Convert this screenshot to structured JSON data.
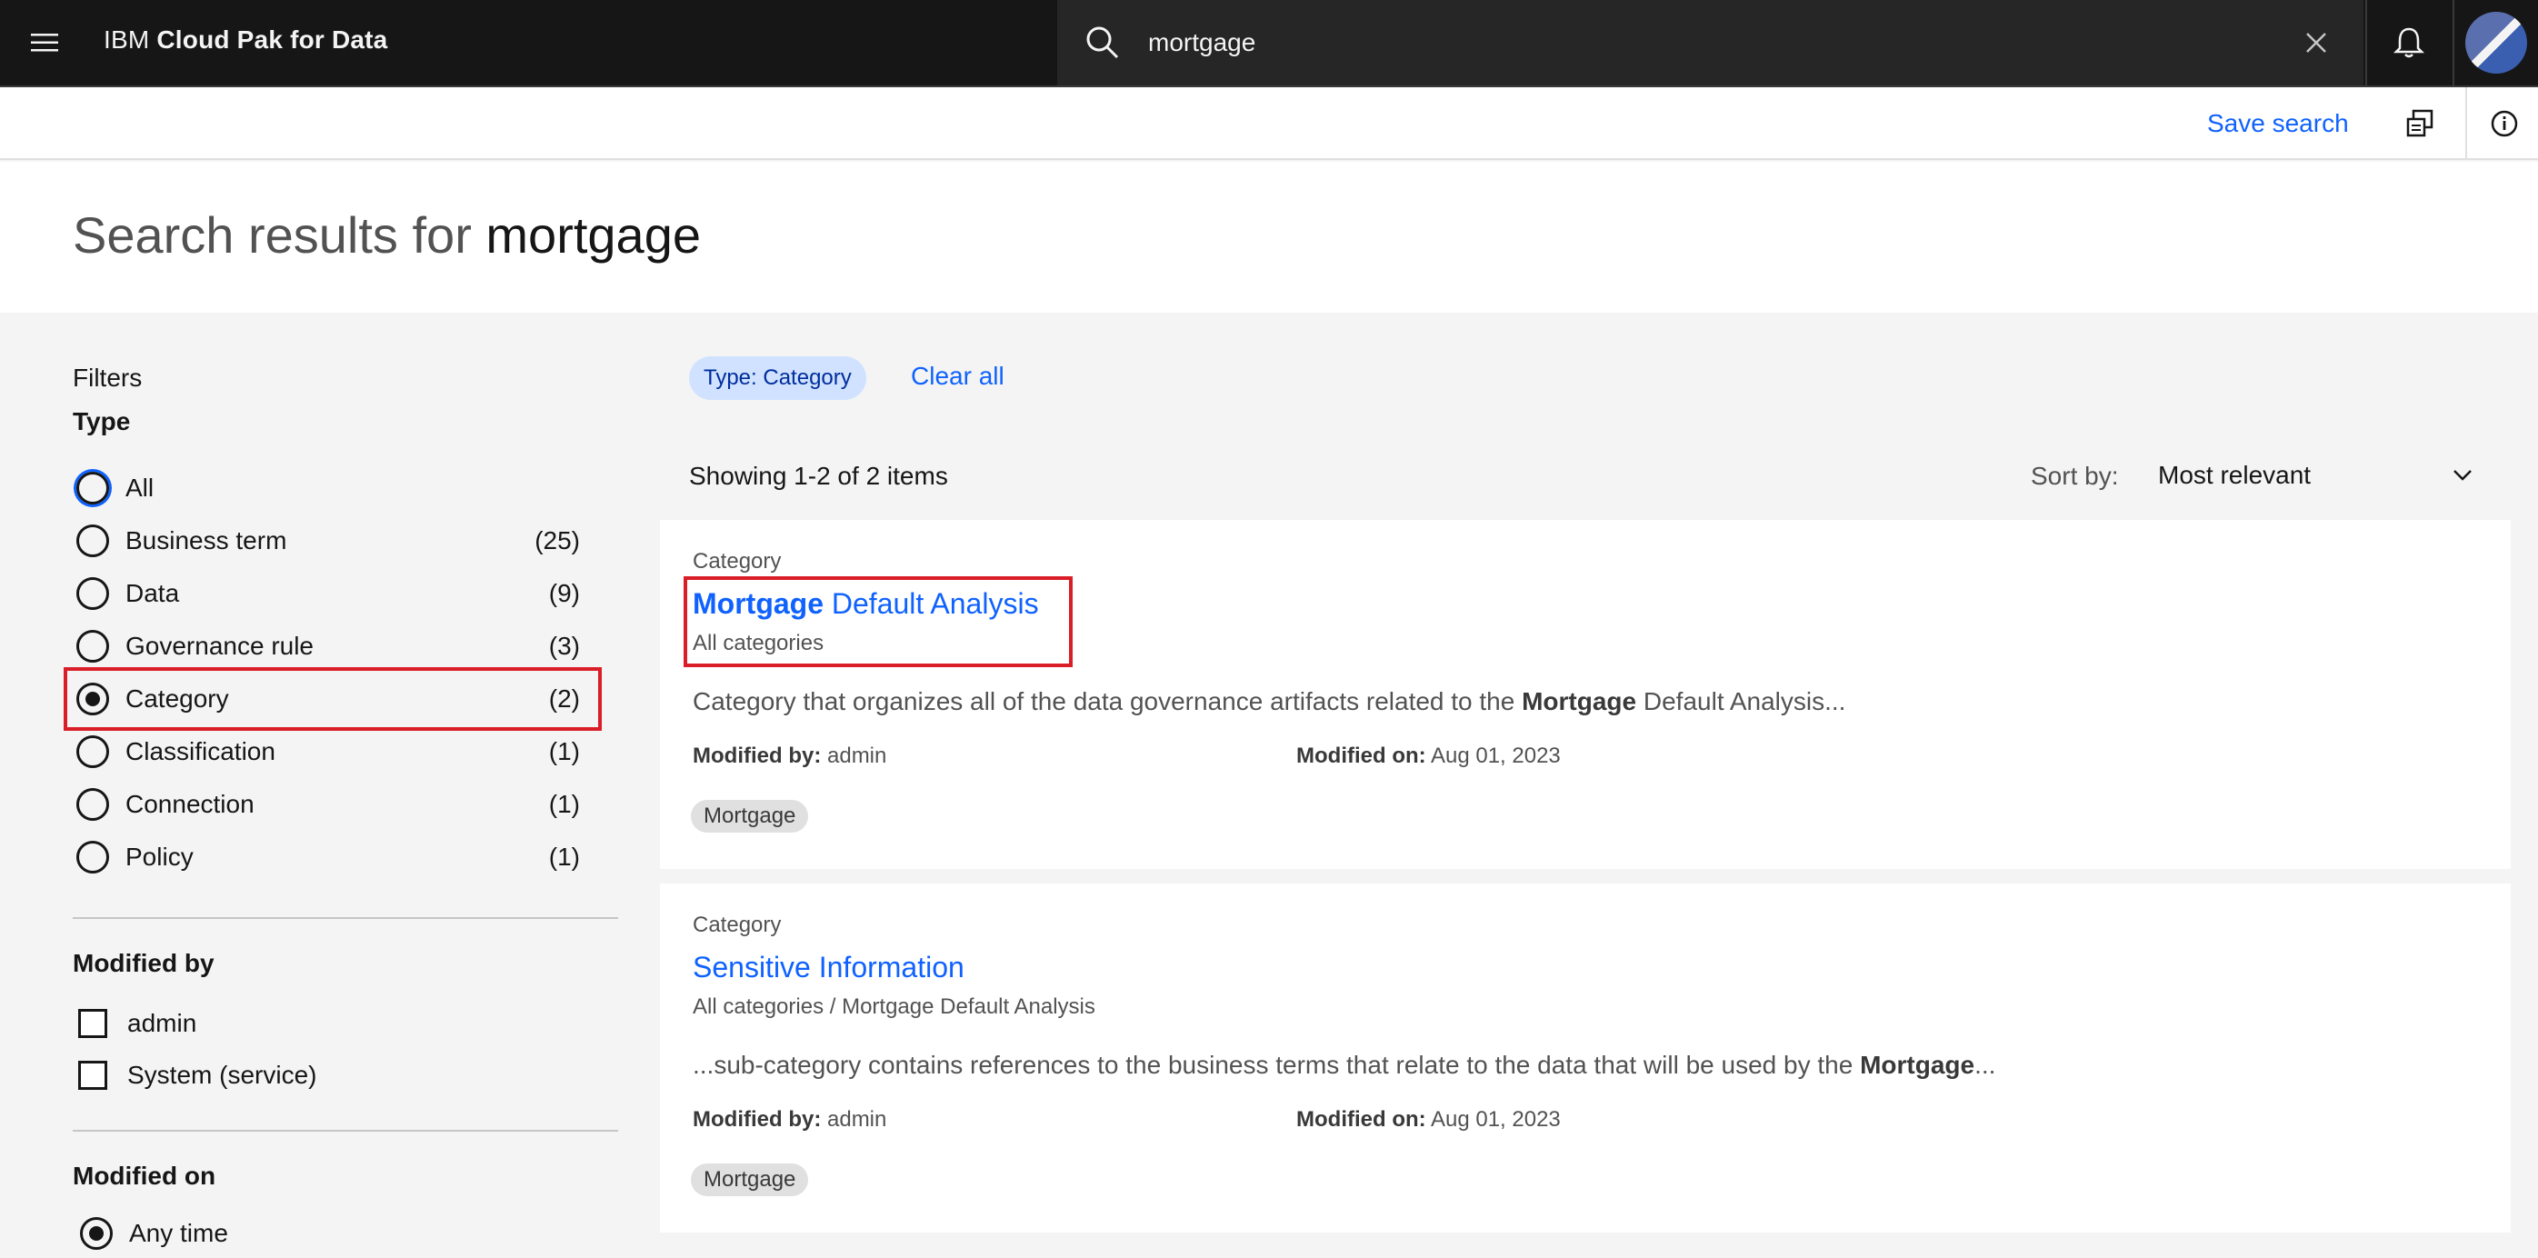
{
  "header": {
    "brand_prefix": "IBM",
    "brand_name": "Cloud Pak for Data",
    "search_value": "mortgage"
  },
  "subheader": {
    "save_search": "Save search"
  },
  "page": {
    "title_prefix": "Search results for",
    "title_query": "mortgage"
  },
  "filters": {
    "label": "Filters",
    "type_heading": "Type",
    "type_options": [
      {
        "label": "All",
        "count": ""
      },
      {
        "label": "Business term",
        "count": "(25)"
      },
      {
        "label": "Data",
        "count": "(9)"
      },
      {
        "label": "Governance rule",
        "count": "(3)"
      },
      {
        "label": "Category",
        "count": "(2)"
      },
      {
        "label": "Classification",
        "count": "(1)"
      },
      {
        "label": "Connection",
        "count": "(1)"
      },
      {
        "label": "Policy",
        "count": "(1)"
      }
    ],
    "modified_by_heading": "Modified by",
    "modified_by_options": [
      "admin",
      "System (service)"
    ],
    "modified_on_heading": "Modified on",
    "modified_on_options": [
      "Any time"
    ]
  },
  "results": {
    "active_filter": "Type: Category",
    "clear_all": "Clear all",
    "showing": "Showing 1-2 of 2 items",
    "sort_label": "Sort by:",
    "sort_value": "Most relevant",
    "items": [
      {
        "type": "Category",
        "title_bold": "Mortgage",
        "title_rest": " Default Analysis",
        "path": "All categories",
        "desc_pre": "Category that organizes all of the data governance artifacts related to the ",
        "desc_bold": "Mortgage",
        "desc_post": " Default Analysis...",
        "modified_by_label": "Modified by:",
        "modified_by": " admin",
        "modified_on_label": "Modified on:",
        "modified_on": " Aug 01, 2023",
        "tag": "Mortgage"
      },
      {
        "type": "Category",
        "title_bold": "",
        "title_rest": "Sensitive Information",
        "path": "All categories / Mortgage Default Analysis",
        "desc_pre": "...sub-category contains references to the business terms that relate to the data that will be used by the ",
        "desc_bold": "Mortgage",
        "desc_post": "...",
        "modified_by_label": "Modified by:",
        "modified_by": " admin",
        "modified_on_label": "Modified on:",
        "modified_on": " Aug 01, 2023",
        "tag": "Mortgage"
      }
    ]
  },
  "colors": {
    "accent": "#0f62fe",
    "highlight": "#da1e28",
    "header_bg": "#161616"
  }
}
